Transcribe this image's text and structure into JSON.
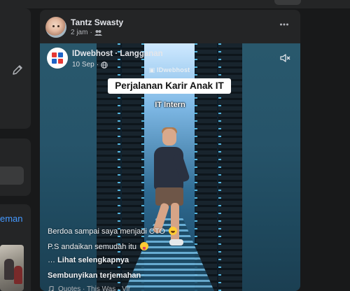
{
  "left_sidebar": {
    "link_fragment": "eman"
  },
  "post": {
    "author": "Tantz Swasty",
    "time": "2 jam",
    "dot": "·",
    "audience_icon": "friends-icon",
    "more_icon": "more-horizontal-icon"
  },
  "shared_post": {
    "page_name": "IDwebhost · Langganan",
    "date": "10 Sep",
    "dot": "·",
    "privacy_icon": "globe-icon",
    "mute_icon": "speaker-muted-icon",
    "video": {
      "watermark": "IDwebhost",
      "title": "Perjalanan Karir Anak IT",
      "subtitle": "IT Intern"
    },
    "caption_line1": "Berdoa sampai saya menjadi CTO",
    "caption_line2": "P.S andaikan semudah itu",
    "see_more_prefix": "… ",
    "see_more": "Lihat selengkapnya",
    "hide_translation": "Sembunyikan terjemahan",
    "translation_meta": "Quotes · This Was · Vir"
  }
}
